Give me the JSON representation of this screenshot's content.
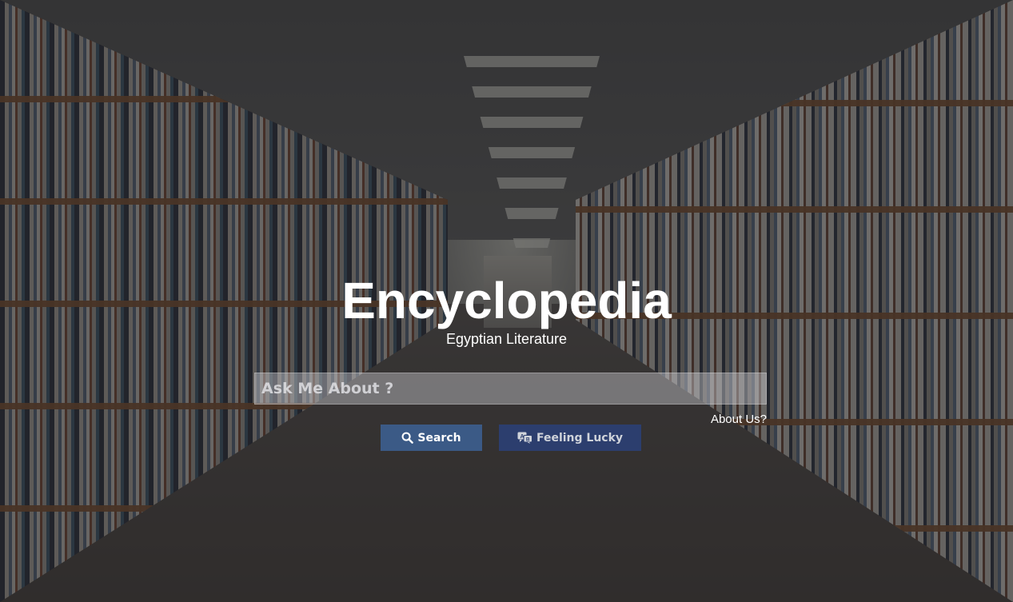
{
  "header": {
    "title": "Encyclopedia",
    "subtitle": "Egyptian Literature"
  },
  "search": {
    "value": "",
    "placeholder": "Ask Me About ?"
  },
  "links": {
    "about": "About Us?"
  },
  "buttons": {
    "search_label": "Search",
    "search_icon": "search-icon",
    "lucky_label": "Feeling Lucky",
    "lucky_icon": "language-icon"
  },
  "colors": {
    "search_button": "#3b5a86",
    "lucky_button": "#2c3e6e",
    "text": "#ffffff"
  }
}
